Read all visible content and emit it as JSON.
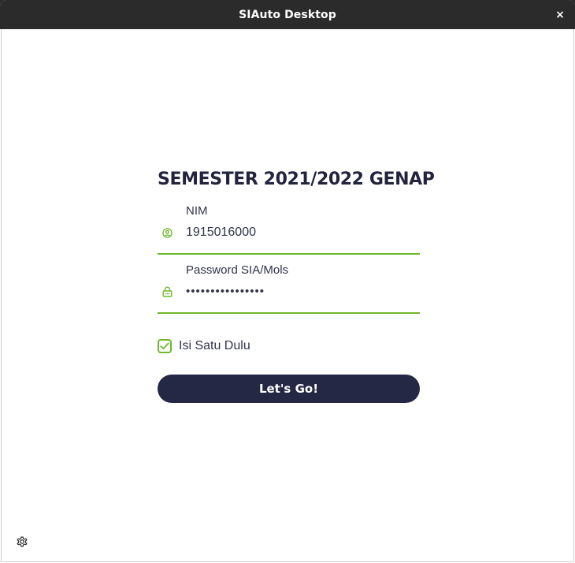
{
  "window": {
    "title": "SIAuto Desktop",
    "close_symbol": "×"
  },
  "form": {
    "heading": "SEMESTER 2021/2022 GENAP",
    "nim": {
      "label": "NIM",
      "value": "1915016000",
      "icon": "user-circle-icon"
    },
    "password": {
      "label": "Password SIA/Mols",
      "value": "••••••••••••••••",
      "icon": "lock-icon"
    },
    "remember": {
      "label": "Isi Satu Dulu",
      "checked": true
    },
    "submit_label": "Let's Go!"
  },
  "footer": {
    "settings_icon": "gear-icon"
  },
  "colors": {
    "accent_green": "#6fb82c",
    "navy": "#252845",
    "titlebar": "#2b2b2b"
  }
}
